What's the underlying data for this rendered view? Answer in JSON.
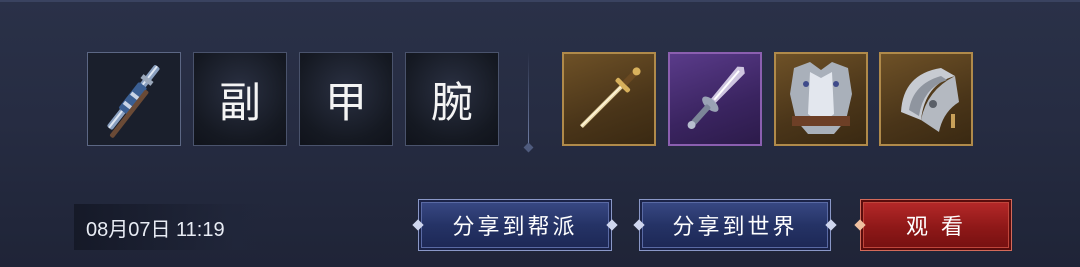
{
  "equipment_row": {
    "slots_left": [
      {
        "kind": "item",
        "icon": "sword-sheath-icon"
      },
      {
        "kind": "label",
        "char": "副"
      },
      {
        "kind": "label",
        "char": "甲"
      },
      {
        "kind": "label",
        "char": "腕"
      }
    ],
    "slots_right": [
      {
        "kind": "item",
        "icon": "golden-sword-icon",
        "rarity_color": "#b08a4a"
      },
      {
        "kind": "item",
        "icon": "purple-dagger-icon",
        "rarity_color": "#8b5fb0"
      },
      {
        "kind": "item",
        "icon": "steel-armor-icon",
        "rarity_color": "#b08a4a"
      },
      {
        "kind": "item",
        "icon": "steel-bracer-icon",
        "rarity_color": "#b08a4a"
      }
    ]
  },
  "footer": {
    "timestamp": "08月07日 11:19",
    "share_guild_label": "分享到帮派",
    "share_world_label": "分享到世界",
    "watch_label": "观 看"
  },
  "colors": {
    "background": "#262c42",
    "button_blue": "#253366",
    "button_red": "#8e1818",
    "rarity_gold": "#b08a4a",
    "rarity_purple": "#8b5fb0"
  }
}
